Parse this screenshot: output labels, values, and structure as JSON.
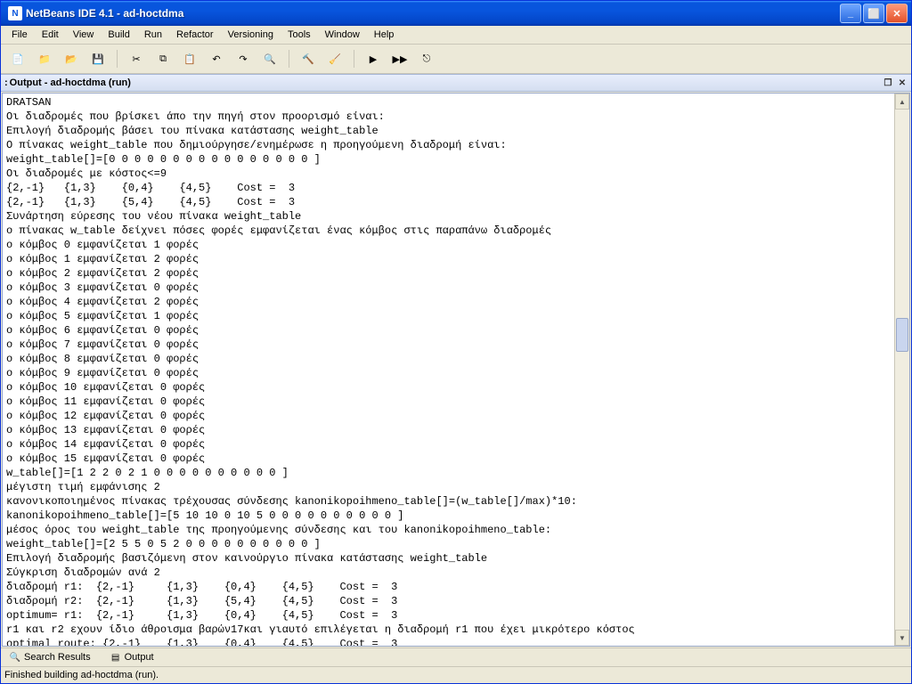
{
  "window_title": "NetBeans IDE 4.1 - ad-hoctdma",
  "menu": [
    "File",
    "Edit",
    "View",
    "Build",
    "Run",
    "Refactor",
    "Versioning",
    "Tools",
    "Window",
    "Help"
  ],
  "panel_title": "Output - ad-hoctdma (run)",
  "bottom_tabs": {
    "search": "Search Results",
    "output": "Output"
  },
  "status": "Finished building ad-hoctdma (run).",
  "toolbar_icons": [
    "new-file-icon",
    "new-project-icon",
    "open-icon",
    "save-all-icon",
    "sep",
    "cut-icon",
    "copy-icon",
    "paste-icon",
    "undo-icon",
    "redo-icon",
    "find-icon",
    "sep",
    "build-icon",
    "clean-build-icon",
    "sep",
    "run-icon",
    "debug-icon",
    "attach-icon"
  ],
  "icon_glyphs": {
    "new-file-icon": "📄",
    "new-project-icon": "📁",
    "open-icon": "📂",
    "save-all-icon": "💾",
    "cut-icon": "✂",
    "copy-icon": "⧉",
    "paste-icon": "📋",
    "undo-icon": "↶",
    "redo-icon": "↷",
    "find-icon": "🔍",
    "build-icon": "🔨",
    "clean-build-icon": "🧹",
    "run-icon": "▶",
    "debug-icon": "▶▶",
    "attach-icon": "⎋"
  },
  "output_lines": [
    "DRATSAN",
    "Οι διαδρομές που βρίσκει άπο την πηγή στον προορισμό είναι:",
    "Επιλογή διαδρομής βάσει του πίνακα κατάστασης weight_table",
    "Ο πίνακας weight_table που δημιούργησε/ενημέρωσε η προηγούμενη διαδρομή είναι:",
    "weight_table[]=[0 0 0 0 0 0 0 0 0 0 0 0 0 0 0 0 ]",
    "Οι διαδρομές με κόστος<=9",
    "{2,-1}   {1,3}    {0,4}    {4,5}    Cost =  3",
    "{2,-1}   {1,3}    {5,4}    {4,5}    Cost =  3",
    "Συνάρτηση εύρεσης του νέου πίνακα weight_table",
    "ο πίνακας w_table δείχνει πόσες φορές εμφανίζεται ένας κόμβος στις παραπάνω διαδρομές",
    "ο κόμβος 0 εμφανίζεται 1 φορές",
    "ο κόμβος 1 εμφανίζεται 2 φορές",
    "ο κόμβος 2 εμφανίζεται 2 φορές",
    "ο κόμβος 3 εμφανίζεται 0 φορές",
    "ο κόμβος 4 εμφανίζεται 2 φορές",
    "ο κόμβος 5 εμφανίζεται 1 φορές",
    "ο κόμβος 6 εμφανίζεται 0 φορές",
    "ο κόμβος 7 εμφανίζεται 0 φορές",
    "ο κόμβος 8 εμφανίζεται 0 φορές",
    "ο κόμβος 9 εμφανίζεται 0 φορές",
    "ο κόμβος 10 εμφανίζεται 0 φορές",
    "ο κόμβος 11 εμφανίζεται 0 φορές",
    "ο κόμβος 12 εμφανίζεται 0 φορές",
    "ο κόμβος 13 εμφανίζεται 0 φορές",
    "ο κόμβος 14 εμφανίζεται 0 φορές",
    "ο κόμβος 15 εμφανίζεται 0 φορές",
    "w_table[]=[1 2 2 0 2 1 0 0 0 0 0 0 0 0 0 0 ]",
    "μέγιστη τιμή εμφάνισης 2",
    "κανονικοποιημένος πίνακας τρέχουσας σύνδεσης kanonikopoihmeno_table[]=(w_table[]/max)*10:",
    "kanonikopoihmeno_table[]=[5 10 10 0 10 5 0 0 0 0 0 0 0 0 0 0 ]",
    "μέσος όρος του weight_table της προηγούμενης σύνδεσης και του kanonikopoihmeno_table:",
    "weight_table[]=[2 5 5 0 5 2 0 0 0 0 0 0 0 0 0 0 ]",
    "Επιλογή διαδρομής βασιζόμενη στον καινούργιο πίνακα κατάστασης weight_table",
    "Σύγκριση διαδρομών ανά 2",
    "διαδρομή r1:  {2,-1}     {1,3}    {0,4}    {4,5}    Cost =  3",
    "διαδρομή r2:  {2,-1}     {1,3}    {5,4}    {4,5}    Cost =  3",
    "optimum= r1:  {2,-1}     {1,3}    {0,4}    {4,5}    Cost =  3",
    "r1 και r2 εχουν ίδιο άθροισμα βαρών17και γιαυτό επιλέγεται η διαδρομή r1 που έχει μικρότερο κόστος",
    "optimal route: {2,-1}    {1,3}    {0,4}    {4,5}    Cost =  3"
  ]
}
